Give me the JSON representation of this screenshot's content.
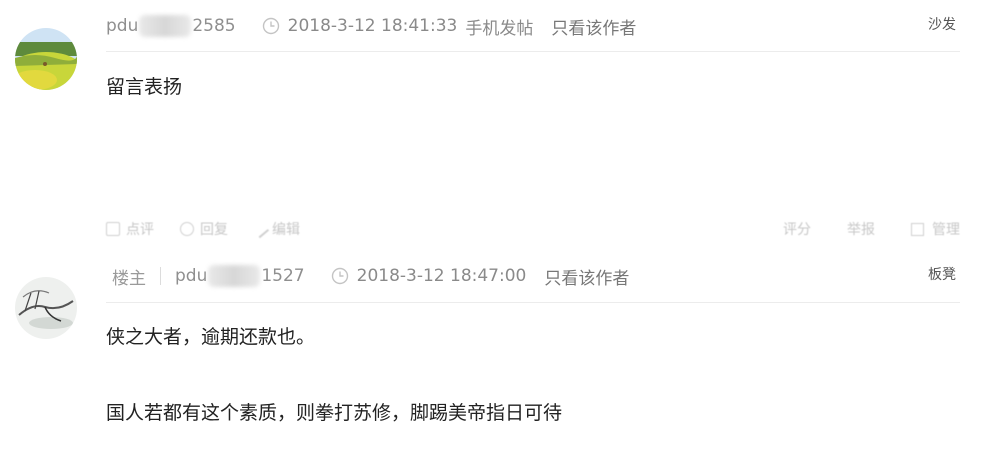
{
  "posts": [
    {
      "username_prefix": "pdu",
      "username_suffix": "2585",
      "timestamp": "2018-3-12 18:41:33",
      "source": "手机发帖",
      "only_author": "只看该作者",
      "floor": "沙发",
      "lines": [
        "留言表扬"
      ],
      "actions": {
        "left": [
          "点评",
          "回复",
          "编辑"
        ],
        "right": [
          "评分",
          "举报",
          "管理"
        ]
      }
    },
    {
      "owner_label": "楼主",
      "username_prefix": "pdu",
      "username_suffix": "1527",
      "timestamp": "2018-3-12 18:47:00",
      "only_author": "只看该作者",
      "floor": "板凳",
      "lines": [
        "侠之大者，逾期还款也。",
        "国人若都有这个素质，则拳打苏修，脚踢美帝指日可待"
      ]
    }
  ],
  "icons": [
    "avatar-landscape-icon",
    "avatar-ink-painting-icon",
    "clock-icon"
  ]
}
